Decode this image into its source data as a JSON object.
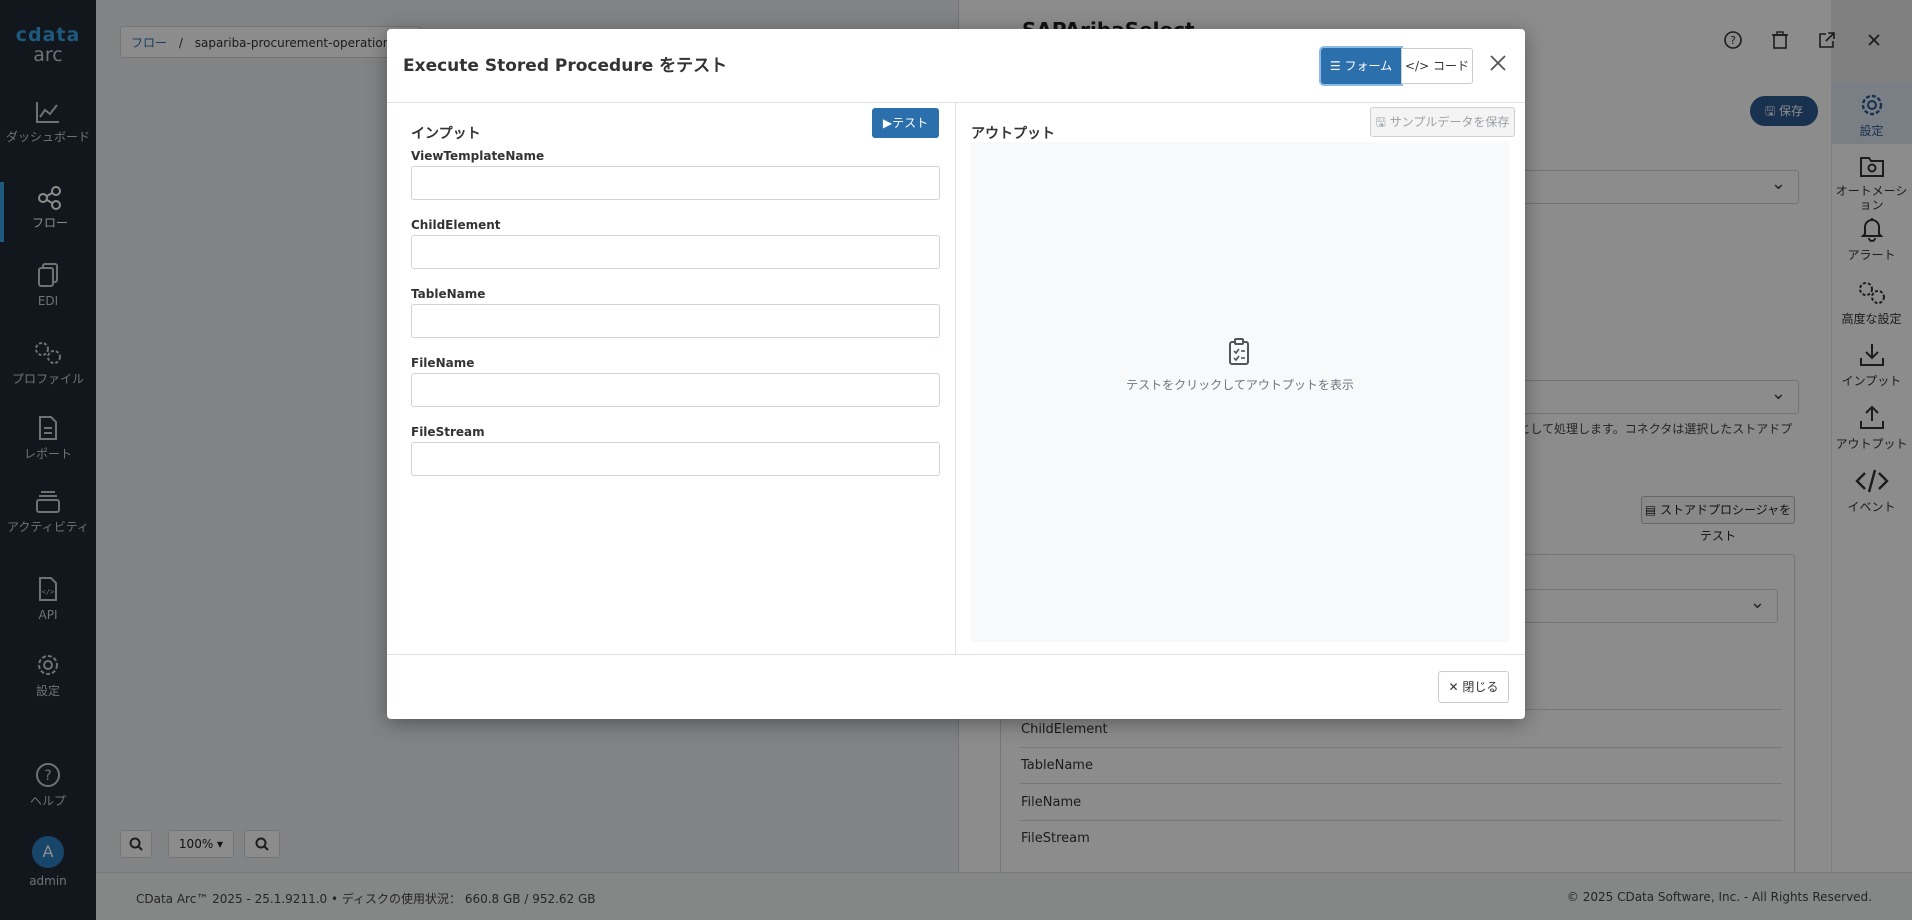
{
  "app": {
    "brand": "cdata",
    "product": "arc"
  },
  "nav": {
    "items": [
      {
        "label": "ダッシュボード",
        "icon": "dashboard-icon"
      },
      {
        "label": "フロー",
        "icon": "flow-icon",
        "active": true
      },
      {
        "label": "EDI",
        "icon": "edi-icon"
      },
      {
        "label": "プロファイル",
        "icon": "profile-icon"
      },
      {
        "label": "レポート",
        "icon": "report-icon"
      },
      {
        "label": "アクティビティ",
        "icon": "activity-icon"
      },
      {
        "label": "API",
        "icon": "api-icon"
      },
      {
        "label": "設定",
        "icon": "settings-icon"
      }
    ],
    "help": "ヘルプ",
    "user": {
      "initial": "A",
      "name": "admin"
    }
  },
  "canvas": {
    "breadcrumb_root": "フロー",
    "breadcrumb_sep": "/",
    "breadcrumb_flow": "sapariba-procurement-operational-",
    "zoom_level": "100% ▾"
  },
  "panel": {
    "title": "SAPAribaSelect",
    "save_label": "保存",
    "description": "-として処理します。コネクタは選択したストアドプロシー",
    "test_sp_label": "ストアドプロシージャをテスト",
    "params": [
      "ChildElement",
      "TableName",
      "FileName",
      "FileStream"
    ]
  },
  "rsidebar": {
    "items": [
      {
        "label": "設定",
        "icon": "gear-icon",
        "active": true
      },
      {
        "label": "オートメーション",
        "icon": "automation-icon"
      },
      {
        "label": "アラート",
        "icon": "bell-icon"
      },
      {
        "label": "高度な設定",
        "icon": "advanced-gear-icon"
      },
      {
        "label": "インプット",
        "icon": "download-icon"
      },
      {
        "label": "アウトプット",
        "icon": "upload-icon"
      },
      {
        "label": "イベント",
        "icon": "code-icon"
      }
    ]
  },
  "footer": {
    "left": "CData Arc™ 2025 - 25.1.9211.0  •  ディスクの使用状況： 660.8 GB / 952.62 GB",
    "right": "© 2025 CData Software, Inc. - All Rights Reserved."
  },
  "modal": {
    "title": "Execute Stored Procedure をテスト",
    "form_label": "フォーム",
    "code_label": "コード",
    "input_heading": "インプット",
    "test_label": "テスト",
    "output_heading": "アウトプット",
    "save_sample_label": "サンプルデータを保存",
    "output_hint": "テストをクリックしてアウトプットを表示",
    "close_label": "閉じる",
    "fields": [
      {
        "label": "ViewTemplateName",
        "value": ""
      },
      {
        "label": "ChildElement",
        "value": ""
      },
      {
        "label": "TableName",
        "value": ""
      },
      {
        "label": "FileName",
        "value": ""
      },
      {
        "label": "FileStream",
        "value": ""
      }
    ]
  },
  "colors": {
    "primary": "#2b6fad",
    "nav_bg": "#1f2a33",
    "accent": "#37a3e6"
  }
}
